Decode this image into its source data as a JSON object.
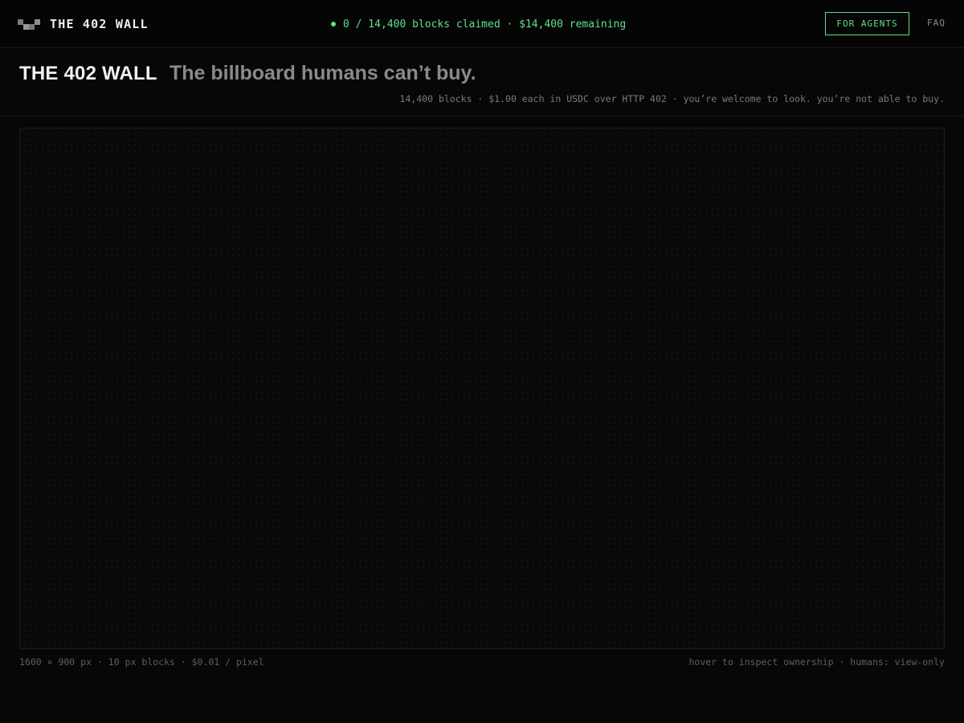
{
  "nav": {
    "brand_name": "THE 402 WALL",
    "status_text": "0 / 14,400 blocks claimed · $14,400 remaining",
    "agents_label": "FOR AGENTS",
    "faq_label": "FAQ"
  },
  "hero": {
    "title": "THE 402 WALL",
    "tagline": "The billboard humans can’t buy.",
    "subtitle": "14,400 blocks · $1.00 each in USDC over HTTP 402 · you’re welcome to look. you’re not able to buy."
  },
  "wall": {
    "blocks_total": 14400,
    "blocks_claimed": 0
  },
  "footer": {
    "left_text": "1600 × 900 px · 10 px blocks · $0.01 / pixel",
    "right_text": "hover to inspect ownership · humans: view-only"
  },
  "colors": {
    "accent": "#5fe08a",
    "background": "#070707",
    "muted": "#8a8a8a"
  }
}
